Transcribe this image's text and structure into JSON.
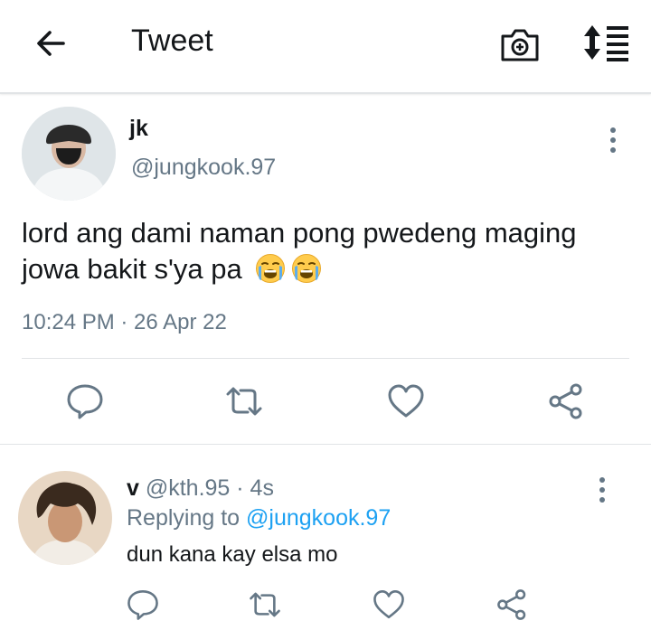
{
  "header": {
    "title": "Tweet",
    "back_icon": "arrow-left-icon",
    "camera_icon": "camera-plus-icon",
    "sort_icon": "sort-list-icon"
  },
  "tweet": {
    "name": "jk",
    "handle": "@jungkook.97",
    "text": "lord ang dami naman pong pwedeng maging jowa bakit s'ya pa",
    "emojis": [
      "loudly-crying-face",
      "loudly-crying-face"
    ],
    "timestamp": "10:24 PM · 26 Apr 22",
    "actions": [
      "reply-icon",
      "retweet-icon",
      "like-icon",
      "share-icon"
    ]
  },
  "reply": {
    "name": "v",
    "handle": "@kth.95",
    "time": " · 4s",
    "replying_prefix": "Replying to ",
    "replying_to": "@jungkook.97",
    "text": "dun kana kay elsa mo",
    "actions": [
      "reply-icon",
      "retweet-icon",
      "like-icon",
      "share-icon"
    ]
  },
  "colors": {
    "text": "#14171a",
    "secondary": "#657786",
    "accent": "#1da1f2",
    "divider": "#e1e4e6"
  }
}
